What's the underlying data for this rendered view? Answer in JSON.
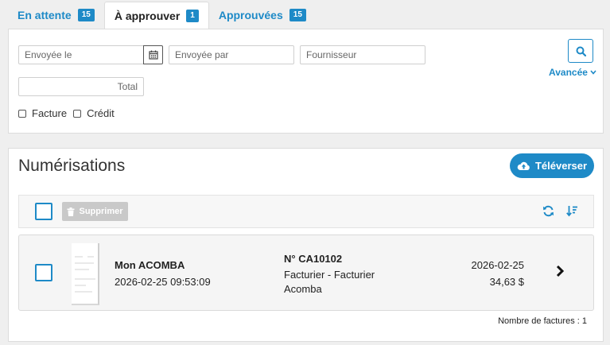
{
  "tabs": [
    {
      "label": "En attente",
      "count": "15"
    },
    {
      "label": "À approuver",
      "count": "1"
    },
    {
      "label": "Approuvées",
      "count": "15"
    }
  ],
  "filters": {
    "sent_on_placeholder": "Envoyée le",
    "sent_by_placeholder": "Envoyée par",
    "supplier_placeholder": "Fournisseur",
    "total_placeholder": "Total",
    "advanced_label": "Avancée",
    "invoice_label": "Facture",
    "credit_label": "Crédit"
  },
  "scans": {
    "title": "Numérisations",
    "upload_label": "Téléverser",
    "delete_label": "Supprimer",
    "count_text": "Nombre de factures : 1"
  },
  "rows": [
    {
      "company": "Mon ACOMBA",
      "datetime": "2026-02-25 09:53:09",
      "number": "N° CA10102",
      "description": "Facturier - Facturier Acomba",
      "date": "2026-02-25",
      "amount": "34,63 $"
    }
  ],
  "colors": {
    "accent": "#1e8ac7",
    "disabled": "#c9c9c9"
  }
}
